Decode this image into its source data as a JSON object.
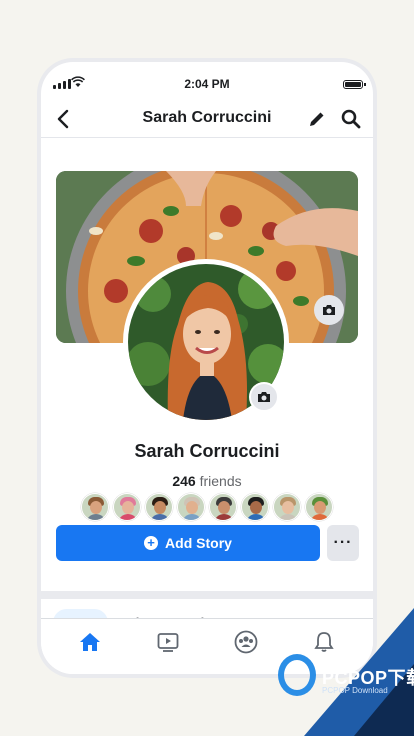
{
  "status_bar": {
    "time": "2:04 PM"
  },
  "header": {
    "title": "Sarah Corruccini"
  },
  "profile": {
    "name": "Sarah Corruccini",
    "friends_count": "246",
    "friends_label": "friends"
  },
  "friends": [
    {
      "name": "friend-1",
      "skin": "#d9a27e",
      "hair": "#8a5a36",
      "shirt": "#6d7f8f"
    },
    {
      "name": "friend-2",
      "skin": "#e6b39a",
      "hair": "#e07a9a",
      "shirt": "#d94b6b"
    },
    {
      "name": "friend-3",
      "skin": "#c58a62",
      "hair": "#2b1d14",
      "shirt": "#4a6da8"
    },
    {
      "name": "friend-4",
      "skin": "#e1b08e",
      "hair": "#cfc3b5",
      "shirt": "#7aa0c4"
    },
    {
      "name": "friend-5",
      "skin": "#c98f6c",
      "hair": "#3b3b3b",
      "shirt": "#9c3a3a"
    },
    {
      "name": "friend-6",
      "skin": "#a86a48",
      "hair": "#1e1e1e",
      "shirt": "#2f6db5"
    },
    {
      "name": "friend-7",
      "skin": "#e7bea0",
      "hair": "#b9956a",
      "shirt": "#c9c3b8"
    },
    {
      "name": "friend-8",
      "skin": "#d99a73",
      "hair": "#5a8f3a",
      "shirt": "#e06a3a"
    }
  ],
  "actions": {
    "add_story": "Add Story",
    "more": "···"
  },
  "tabs": [
    {
      "label": "Posts",
      "active": true
    },
    {
      "label": "About",
      "active": false
    },
    {
      "label": "Photos",
      "active": false
    },
    {
      "label": "Mo",
      "active": false
    }
  ],
  "bottom_nav": [
    {
      "icon": "home-icon",
      "active": true
    },
    {
      "icon": "watch-icon",
      "active": false
    },
    {
      "icon": "groups-icon",
      "active": false
    },
    {
      "icon": "notifications-bell-icon",
      "active": false
    }
  ],
  "colors": {
    "accent": "#1877f2",
    "text_primary": "#1c1e21",
    "text_secondary": "#65676b"
  },
  "watermark": {
    "text": "PCPOP下载",
    "subtext": "PCPOP Download"
  }
}
